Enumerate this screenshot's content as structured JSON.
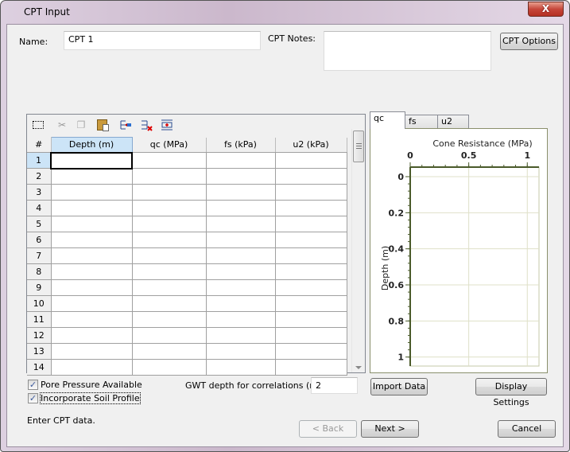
{
  "window": {
    "title": "CPT Input",
    "close_label": "X"
  },
  "name_field": {
    "label": "Name:",
    "value": "CPT 1"
  },
  "notes_field": {
    "label": "CPT Notes:",
    "value": ""
  },
  "cpt_options_label": "CPT Options",
  "toolbar": {
    "icons": [
      "select-all-icon",
      "cut-icon",
      "copy-icon",
      "paste-icon",
      "insert-row-icon",
      "delete-row-icon",
      "append-row-icon"
    ]
  },
  "grid": {
    "row_header": "#",
    "columns": [
      "Depth (m)",
      "qc (MPa)",
      "fs (kPa)",
      "u2 (kPa)"
    ],
    "rows": [
      "1",
      "2",
      "3",
      "4",
      "5",
      "6",
      "7",
      "8",
      "9",
      "10",
      "11",
      "12",
      "13",
      "14"
    ],
    "selected_row": "1",
    "selected_column": "Depth (m)"
  },
  "options": {
    "pore_pressure": {
      "label": "Pore Pressure Available",
      "checked": true
    },
    "soil_profile": {
      "label": "Incorporate Soil Profile",
      "checked": true
    }
  },
  "gwt": {
    "label": "GWT depth for correlations (m):",
    "value": "2"
  },
  "chart_tabs": [
    "qc",
    "fs",
    "u2"
  ],
  "active_chart_tab": "qc",
  "chart_data": {
    "type": "line",
    "title": "Cone Resistance (MPa)",
    "xlabel": "Cone Resistance (MPa)",
    "ylabel": "Depth (m)",
    "xlim": [
      0,
      1.1
    ],
    "ylim": [
      0,
      1.05
    ],
    "x_ticks": [
      "0",
      "0.5",
      "1"
    ],
    "x_tick_values": [
      0,
      0.5,
      1
    ],
    "y_ticks": [
      "0",
      "0.2",
      "0.4",
      "0.6",
      "0.8",
      "1"
    ],
    "y_tick_values": [
      0,
      0.2,
      0.4,
      0.6,
      0.8,
      1
    ],
    "y_inverted": true,
    "x_axis_position": "top",
    "grid": true,
    "series": []
  },
  "buttons": {
    "import": "Import Data",
    "display_settings": "Display Settings",
    "back": "< Back",
    "next": "Next >",
    "cancel": "Cancel"
  },
  "status_text": "Enter CPT data."
}
